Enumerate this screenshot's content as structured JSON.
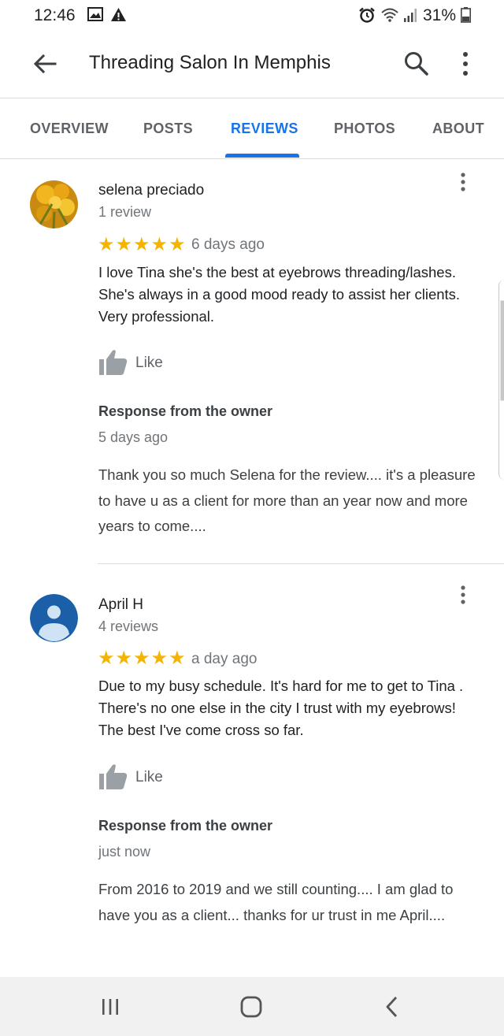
{
  "status_bar": {
    "time": "12:46",
    "battery": "31%",
    "icons": [
      "image-icon",
      "warning-icon",
      "alarm-icon",
      "wifi-icon",
      "signal-icon",
      "battery-icon"
    ]
  },
  "app_bar": {
    "title": "Threading Salon In Memphis",
    "icons": [
      "back-arrow-icon",
      "search-icon",
      "more-vert-icon"
    ]
  },
  "tabs": {
    "items": [
      "OVERVIEW",
      "POSTS",
      "REVIEWS",
      "PHOTOS",
      "ABOUT"
    ],
    "active": "REVIEWS"
  },
  "colors": {
    "accent": "#1a73e8",
    "star": "#f4b400",
    "secondary_text": "#70757a",
    "avatar_blue": "#1a5fa8"
  },
  "reviews": [
    {
      "name": "selena preciado",
      "review_count": "1 review",
      "rating": 5,
      "stars": "★★★★★",
      "time": "6 days ago",
      "text": "I love Tina she's the best at eyebrows threading/lashes. She's always in a good mood ready to assist her clients. Very professional.",
      "like_label": "Like",
      "response": {
        "title": "Response from the owner",
        "time": "5 days ago",
        "text": "Thank you so much Selena for the review.... it's a pleasure to have u as a client for more than an year now and more years to come...."
      }
    },
    {
      "name": "April H",
      "review_count": "4 reviews",
      "rating": 5,
      "stars": "★★★★★",
      "time": "a day ago",
      "text": "Due to my busy schedule. It's hard for me to get to Tina . There's no one else in the city I trust with my eyebrows! The best I've come cross so far.",
      "like_label": "Like",
      "response": {
        "title": "Response from the owner",
        "time": "just now",
        "text": "From 2016 to 2019 and we still counting.... I am glad to have you as a client... thanks for ur trust in me April...."
      }
    }
  ],
  "nav_bar": {
    "icons": [
      "recents-icon",
      "home-icon",
      "back-icon"
    ]
  }
}
